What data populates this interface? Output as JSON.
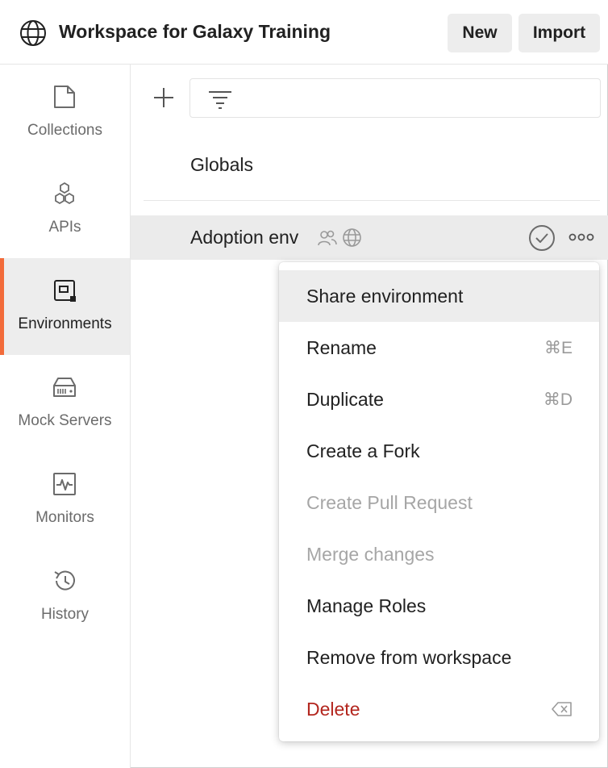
{
  "header": {
    "workspace_title": "Workspace for Galaxy Training",
    "new_label": "New",
    "import_label": "Import"
  },
  "sidebar": {
    "items": [
      {
        "label": "Collections",
        "icon": "collections-icon",
        "active": false
      },
      {
        "label": "APIs",
        "icon": "apis-icon",
        "active": false
      },
      {
        "label": "Environments",
        "icon": "environments-icon",
        "active": true
      },
      {
        "label": "Mock Servers",
        "icon": "mock-servers-icon",
        "active": false
      },
      {
        "label": "Monitors",
        "icon": "monitors-icon",
        "active": false
      },
      {
        "label": "History",
        "icon": "history-icon",
        "active": false
      }
    ],
    "active_color": "#f26b3a"
  },
  "main": {
    "globals_label": "Globals",
    "environment": {
      "name": "Adoption env"
    }
  },
  "context_menu": {
    "items": [
      {
        "label": "Share environment",
        "shortcut": "",
        "state": "hover"
      },
      {
        "label": "Rename",
        "shortcut": "⌘E",
        "state": "normal"
      },
      {
        "label": "Duplicate",
        "shortcut": "⌘D",
        "state": "normal"
      },
      {
        "label": "Create a Fork",
        "shortcut": "",
        "state": "normal"
      },
      {
        "label": "Create Pull Request",
        "shortcut": "",
        "state": "disabled"
      },
      {
        "label": "Merge changes",
        "shortcut": "",
        "state": "disabled"
      },
      {
        "label": "Manage Roles",
        "shortcut": "",
        "state": "normal"
      },
      {
        "label": "Remove from workspace",
        "shortcut": "",
        "state": "normal"
      },
      {
        "label": "Delete",
        "shortcut": "",
        "state": "danger"
      }
    ],
    "danger_color": "#b3261e"
  }
}
